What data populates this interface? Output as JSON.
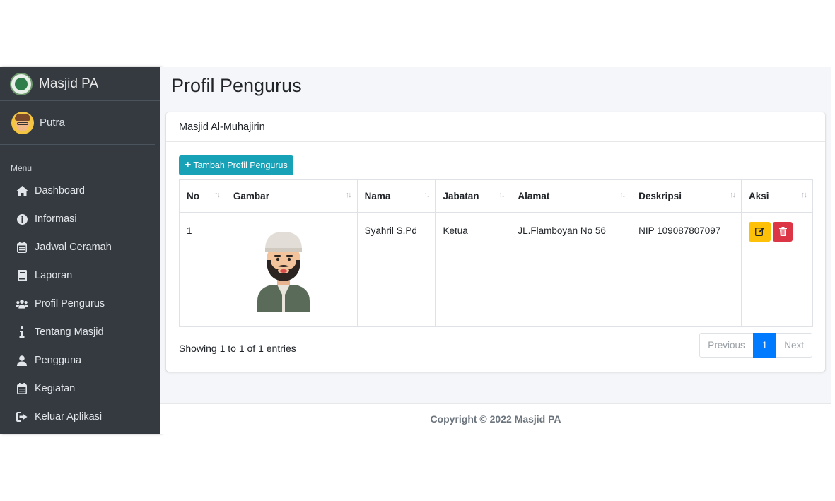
{
  "brand": {
    "name": "Masjid PA"
  },
  "user": {
    "name": "Putra"
  },
  "sidebar": {
    "menu_header": "Menu",
    "items": [
      {
        "label": "Dashboard",
        "icon": "home-icon"
      },
      {
        "label": "Informasi",
        "icon": "info-circle-icon"
      },
      {
        "label": "Jadwal Ceramah",
        "icon": "calendar-icon"
      },
      {
        "label": "Laporan",
        "icon": "book-icon"
      },
      {
        "label": "Profil Pengurus",
        "icon": "users-icon"
      },
      {
        "label": "Tentang Masjid",
        "icon": "info-icon"
      },
      {
        "label": "Pengguna",
        "icon": "user-icon"
      },
      {
        "label": "Kegiatan",
        "icon": "calendar-icon"
      },
      {
        "label": "Keluar Aplikasi",
        "icon": "sign-out-icon"
      }
    ]
  },
  "page": {
    "title": "Profil Pengurus"
  },
  "card": {
    "title": "Masjid Al-Muhajirin",
    "add_button": "Tambah Profil Pengurus"
  },
  "table": {
    "columns": [
      "No",
      "Gambar",
      "Nama",
      "Jabatan",
      "Alamat",
      "Deskripsi",
      "Aksi"
    ],
    "rows": [
      {
        "no": "1",
        "nama": "Syahril S.Pd",
        "jabatan": "Ketua",
        "alamat": "JL.Flamboyan No 56",
        "deskripsi": "NIP 109087807097"
      }
    ]
  },
  "footer_info": "Showing 1 to 1 of 1 entries",
  "pagination": {
    "previous": "Previous",
    "current": "1",
    "next": "Next"
  },
  "footer": {
    "copyright": "Copyright © 2022 Masjid PA"
  },
  "colors": {
    "sidebar": "#343a40",
    "add_button": "#17a2b8",
    "edit_button": "#ffc107",
    "delete_button": "#dc3545",
    "active_page": "#007bff"
  }
}
